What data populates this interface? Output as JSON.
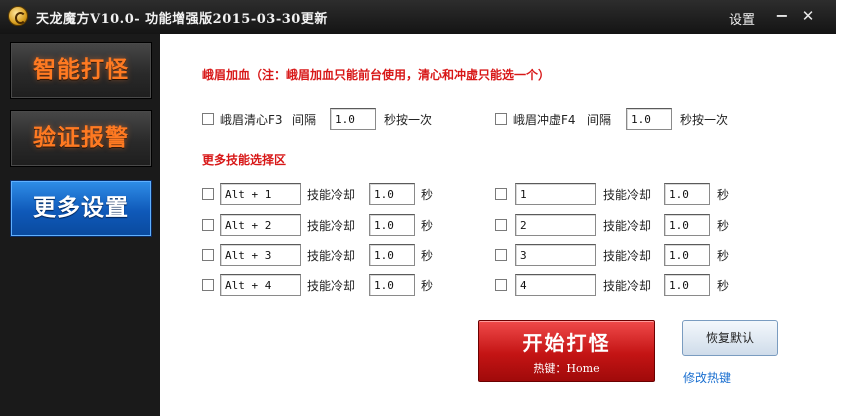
{
  "titlebar": {
    "title": "天龙魔方V10.0- 功能增强版2015-03-30更新",
    "settings": "设置",
    "minimize": "−",
    "close": "✕"
  },
  "sidebar": {
    "items": [
      {
        "label": "智能打怪",
        "active": false
      },
      {
        "label": "验证报警",
        "active": false
      },
      {
        "label": "更多设置",
        "active": true
      }
    ]
  },
  "emei": {
    "note": "峨眉加血（注：峨眉加血只能前台使用，清心和冲虚只能选一个）",
    "qingxin": {
      "label": "峨眉清心F3",
      "interval_label": "间隔",
      "value": "1.0",
      "suffix": "秒按一次"
    },
    "chongxu": {
      "label": "峨眉冲虚F4",
      "interval_label": "间隔",
      "value": "1.0",
      "suffix": "秒按一次"
    }
  },
  "skills": {
    "section_title": "更多技能选择区",
    "cooldown_label": "技能冷却",
    "unit": "秒",
    "left": [
      {
        "key": "Alt + 1",
        "cooldown": "1.0"
      },
      {
        "key": "Alt + 2",
        "cooldown": "1.0"
      },
      {
        "key": "Alt + 3",
        "cooldown": "1.0"
      },
      {
        "key": "Alt + 4",
        "cooldown": "1.0"
      }
    ],
    "right": [
      {
        "key": "1",
        "cooldown": "1.0"
      },
      {
        "key": "2",
        "cooldown": "1.0"
      },
      {
        "key": "3",
        "cooldown": "1.0"
      },
      {
        "key": "4",
        "cooldown": "1.0"
      }
    ]
  },
  "actions": {
    "start": "开始打怪",
    "start_hotkey": "热键：Home",
    "restore": "恢复默认",
    "modify_hotkey": "修改热键"
  }
}
